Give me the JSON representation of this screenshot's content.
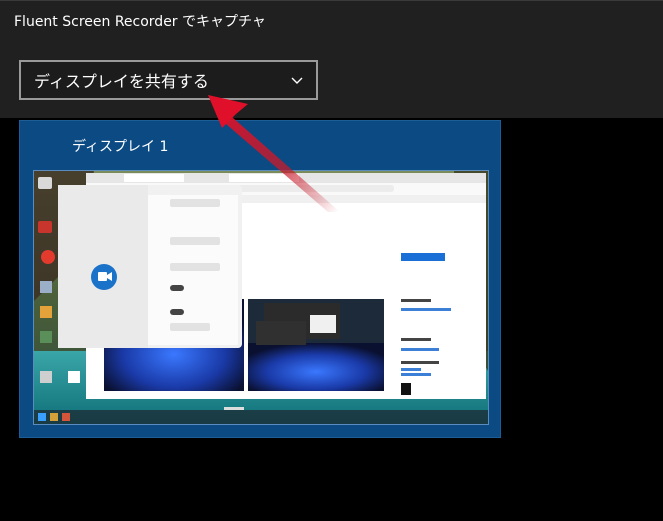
{
  "dialog": {
    "title": "Fluent Screen Recorder でキャプチャ",
    "select": {
      "selected_label": "ディスプレイを共有する",
      "icon": "chevron-down-icon"
    }
  },
  "display_tile": {
    "label": "ディスプレイ 1"
  },
  "colors": {
    "dialog_bg": "#202020",
    "select_border": "#9a9a9a",
    "tile_bg": "#0b4a82",
    "annotation_arrow": "#d11a2a"
  }
}
